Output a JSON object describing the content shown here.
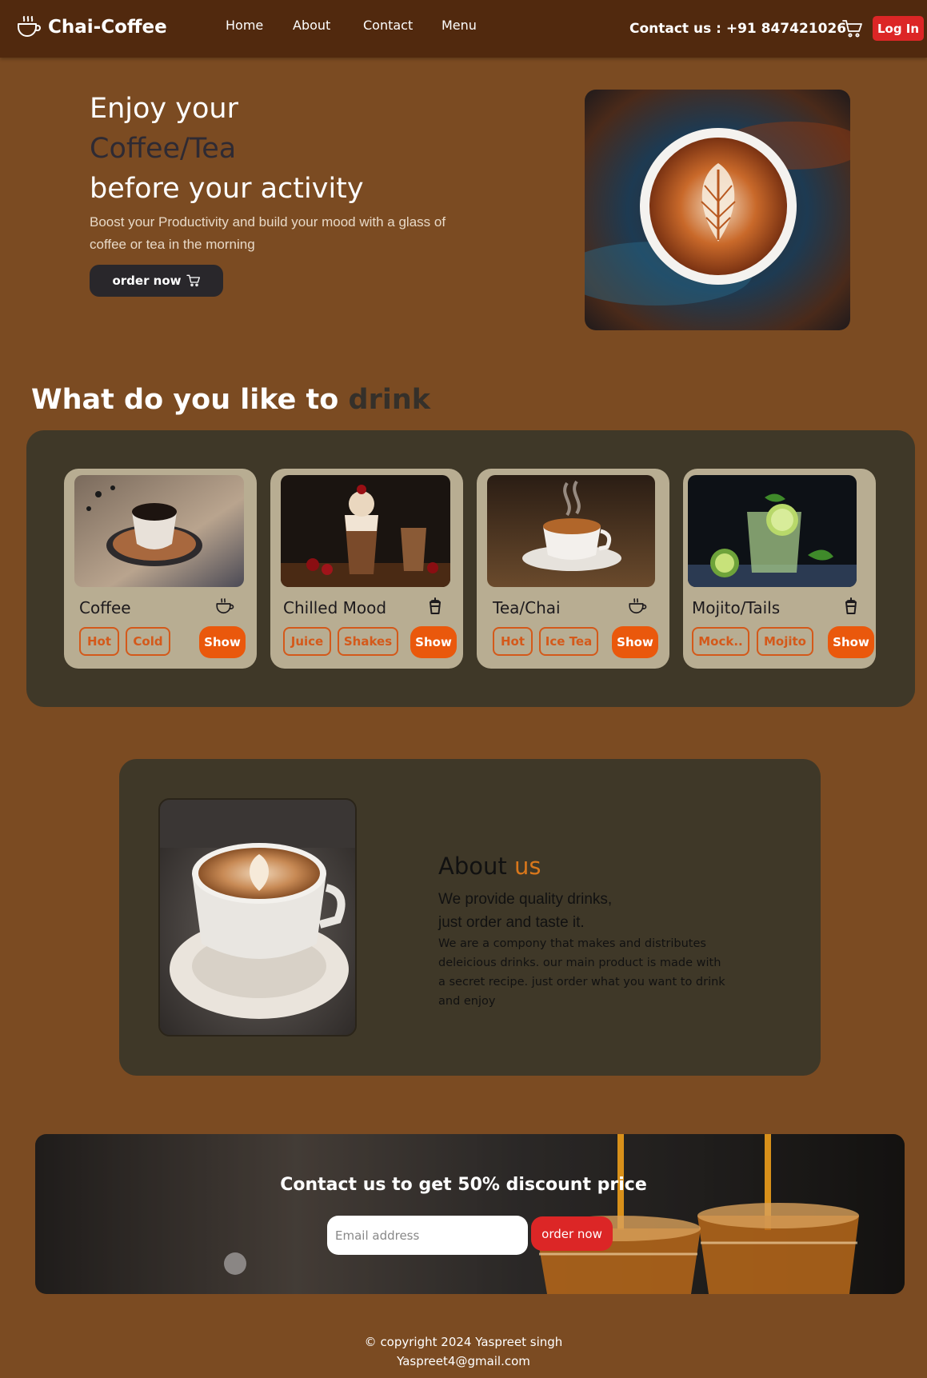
{
  "colors": {
    "page_bg": "#7b4b22",
    "navbar_bg": "#51290e",
    "panel_bg": "#3f3828",
    "card_bg": "#b8ad92",
    "accent_orange": "#ea580c",
    "login_red": "#dc2626"
  },
  "navbar": {
    "brand": "Chai-Coffee",
    "links": [
      "Home",
      "About",
      "Contact",
      "Menu"
    ],
    "contact": "Contact us : +91 847421026",
    "login": "Log In"
  },
  "hero": {
    "line1": "Enjoy your",
    "line2": "Coffee/Tea",
    "line3": "before your activity",
    "subtitle": "Boost your Productivity and build your mood with a glass of coffee or tea in the morning",
    "order_button": "order now"
  },
  "drinks": {
    "title_main": "What do you like to ",
    "title_accent": "drink",
    "cards": [
      {
        "title": "Coffee",
        "icon": "coffee-cup-icon",
        "tags": [
          "Hot",
          "Cold"
        ],
        "button": "Show"
      },
      {
        "title": "Chilled Mood",
        "icon": "drink-cup-icon",
        "tags": [
          "Juice",
          "Shakes"
        ],
        "button": "Show"
      },
      {
        "title": "Tea/Chai",
        "icon": "coffee-cup-icon",
        "tags": [
          "Hot",
          "Ice Tea"
        ],
        "button": "Show"
      },
      {
        "title": "Mojito/Tails",
        "icon": "drink-cup-icon",
        "tags": [
          "Mock..",
          "Mojito"
        ],
        "button": "Show"
      }
    ]
  },
  "about": {
    "title_main": "About ",
    "title_accent": "us",
    "sub_line1": "We provide quality drinks,",
    "sub_line2": "just order and taste it.",
    "body": "We are a compony that makes and distributes deleicious drinks. our main product is made with a secret recipe. just order what you want to drink and enjoy"
  },
  "contact_banner": {
    "title": "Contact us to get 50% discount price",
    "email_placeholder": "Email address",
    "button": "order now"
  },
  "footer": {
    "copyright": "© copyright 2024 Yaspreet singh",
    "email": "Yaspreet4@gmail.com"
  }
}
